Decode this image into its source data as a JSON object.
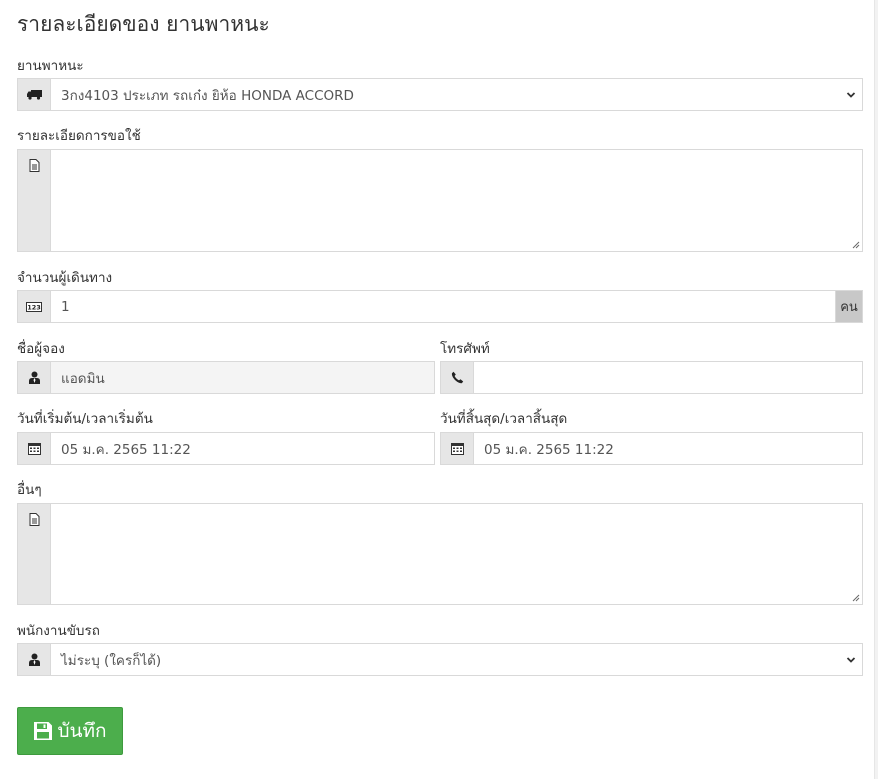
{
  "title": "รายละเอียดของ ยานพาหนะ",
  "vehicle": {
    "label": "ยานพาหนะ",
    "icon": "truck-icon",
    "value": "3กง4103 ประเภท รถเก๋ง ยิห้อ HONDA ACCORD"
  },
  "request_detail": {
    "label": "รายละเอียดการขอใช้",
    "icon": "document-icon",
    "value": ""
  },
  "passengers": {
    "label": "จำนวนผู้เดินทาง",
    "icon": "number-123-icon",
    "value": "1",
    "unit": "คน"
  },
  "booker": {
    "label": "ชื่อผู้จอง",
    "icon": "user-icon",
    "value": "แอดมิน"
  },
  "phone": {
    "label": "โทรศัพท์",
    "icon": "phone-icon",
    "value": ""
  },
  "start": {
    "label": "วันที่เริ่มต้น/เวลาเริ่มต้น",
    "icon": "calendar-icon",
    "value": "05 ม.ค. 2565 11:22"
  },
  "end": {
    "label": "วันที่สิ้นสุด/เวลาสิ้นสุด",
    "icon": "calendar-icon",
    "value": "05 ม.ค. 2565 11:22"
  },
  "other": {
    "label": "อื่นๆ",
    "icon": "document-icon",
    "value": ""
  },
  "driver": {
    "label": "พนักงานขับรถ",
    "icon": "user-icon",
    "value": "ไม่ระบุ (ใครก็ได้)"
  },
  "save": {
    "label": "บันทึก",
    "icon": "floppy-disk-icon",
    "color": "#4cae4c"
  }
}
